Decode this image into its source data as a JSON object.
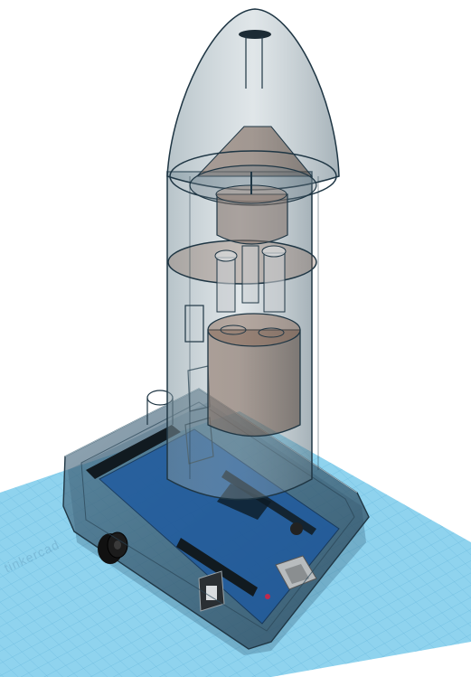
{
  "viewport": {
    "workplane_color": "#8fd3ee",
    "grid_line_color": "#5fb3d8",
    "shell_stroke": "#1f3644",
    "shell_fill": "#6e8591",
    "board_color": "#1e5aa0"
  },
  "workplane": {
    "watermark": "tinkercad"
  }
}
